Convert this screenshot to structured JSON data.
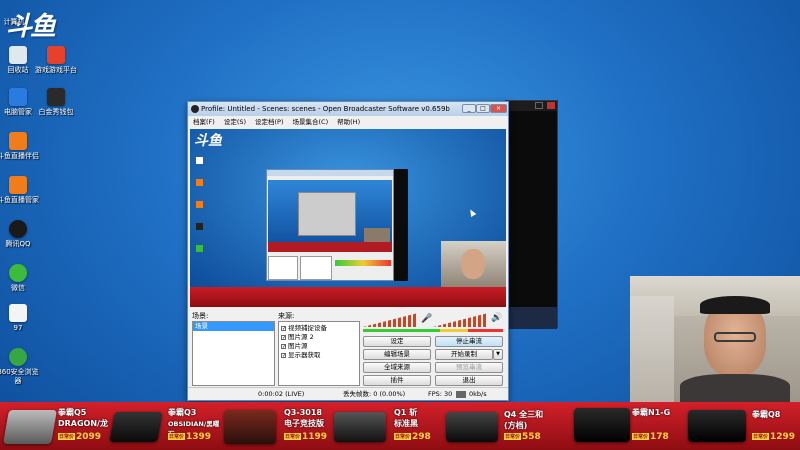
{
  "desktop": {
    "logo": "斗鱼",
    "icons": [
      {
        "label": "计算机"
      },
      {
        "label": "回收站"
      },
      {
        "label": "游戏游戏平台"
      },
      {
        "label": "电脑管家"
      },
      {
        "label": "白金秀钱包"
      },
      {
        "label": "斗鱼直播伴侣"
      },
      {
        "label": "斗鱼直播管家"
      },
      {
        "label": "腾讯QQ"
      },
      {
        "label": "微信"
      },
      {
        "label": "97"
      },
      {
        "label": "360安全浏览器"
      }
    ]
  },
  "obs": {
    "title": "Profile: Untitled - Scenes: scenes - Open Broadcaster Software v0.659b",
    "menu": [
      "档案(F)",
      "设定(S)",
      "设定档(P)",
      "场景集合(C)",
      "帮助(H)"
    ],
    "scenes_label": "场景:",
    "scenes": [
      "场景"
    ],
    "sources_label": "来源:",
    "sources": [
      "视频捕捉设备",
      "图片源 2",
      "图片源",
      "显示器获取"
    ],
    "buttons": {
      "settings": "设定",
      "stop_stream": "停止串流",
      "edit_scene": "编辑场景",
      "start_record": "开始录制",
      "global_sources": "全域来源",
      "preview_stream": "预览串流",
      "plugins": "插件",
      "exit": "退出"
    },
    "status": {
      "time": "0:00:02 (LIVE)",
      "dropped": "丢失帧数: 0 (0.00%)",
      "fps": "FPS: 30",
      "bitrate": "0kb/s"
    },
    "preview_logo": "斗鱼"
  },
  "banner": {
    "products": [
      {
        "name": "拳霸Q5",
        "sub": "DRAGON/龙",
        "price": "2099",
        "tag": "日常价"
      },
      {
        "name": "拳霸Q3",
        "sub": "OBSIDIAN/黑曜石",
        "price": "1399",
        "tag": "日常价"
      },
      {
        "name": "Q3-3018",
        "sub": "电子竞技版",
        "price": "1199",
        "tag": "日常价"
      },
      {
        "name": "Q1 斩",
        "sub": "标准黑",
        "price": "298",
        "tag": "日常价"
      },
      {
        "name": "Q4 全三和",
        "sub": "(方档)",
        "price": "558",
        "tag": "日常价"
      },
      {
        "name": "拳霸N1-G",
        "sub": "",
        "price": "178",
        "tag": "日常价"
      },
      {
        "name": "拳霸Q8",
        "sub": "",
        "price": "1299",
        "tag": "日常价"
      }
    ]
  },
  "colors": {
    "accent": "#d4202a",
    "price": "#ffd43a",
    "desktop": "#1f6fc4"
  }
}
